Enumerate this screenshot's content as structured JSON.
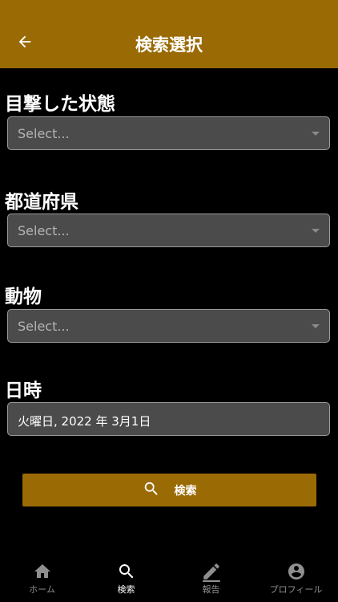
{
  "header": {
    "title": "検索選択",
    "back_icon": "arrow-left-icon",
    "background": "#9a6a05"
  },
  "fields": {
    "status": {
      "label": "目撃した状態",
      "placeholder": "Select..."
    },
    "prefecture": {
      "label": "都道府県",
      "placeholder": "Select..."
    },
    "animal": {
      "label": "動物",
      "placeholder": "Select..."
    },
    "datetime": {
      "label": "日時",
      "value": "火曜日, 2022 年 3月1日"
    }
  },
  "search_button": {
    "label": "検索",
    "icon": "search-icon",
    "color": "#9a6a05"
  },
  "tabbar": {
    "tabs": [
      {
        "label": "ホーム",
        "icon": "home-icon",
        "active": false
      },
      {
        "label": "検索",
        "icon": "search-icon",
        "active": true
      },
      {
        "label": "報告",
        "icon": "edit-icon",
        "active": false
      },
      {
        "label": "プロフィール",
        "icon": "account-icon",
        "active": false
      }
    ]
  }
}
